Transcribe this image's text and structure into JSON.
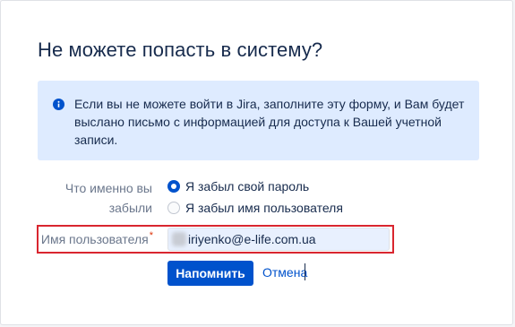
{
  "dialog": {
    "title": "Не можете попасть в систему?",
    "info": {
      "icon": "info-icon",
      "text": "Если вы не можете войти в Jira, заполните эту форму, и Вам будет выслано письмо с информацией для доступа к Вашей учетной записи."
    },
    "forgot": {
      "label": "Что именно вы забыли",
      "options": [
        {
          "label": "Я забыл свой пароль",
          "checked": true
        },
        {
          "label": "Я забыл имя пользователя",
          "checked": false
        }
      ]
    },
    "username": {
      "label": "Имя пользователя",
      "required_mark": "*",
      "value": "iriyenko@e-life.com.ua"
    },
    "actions": {
      "submit_label": "Напомнить",
      "cancel_label": "Отмена"
    }
  },
  "colors": {
    "primary": "#0052cc",
    "info_background": "#deebff",
    "highlight_border": "#d9262f",
    "required": "#de350b"
  }
}
